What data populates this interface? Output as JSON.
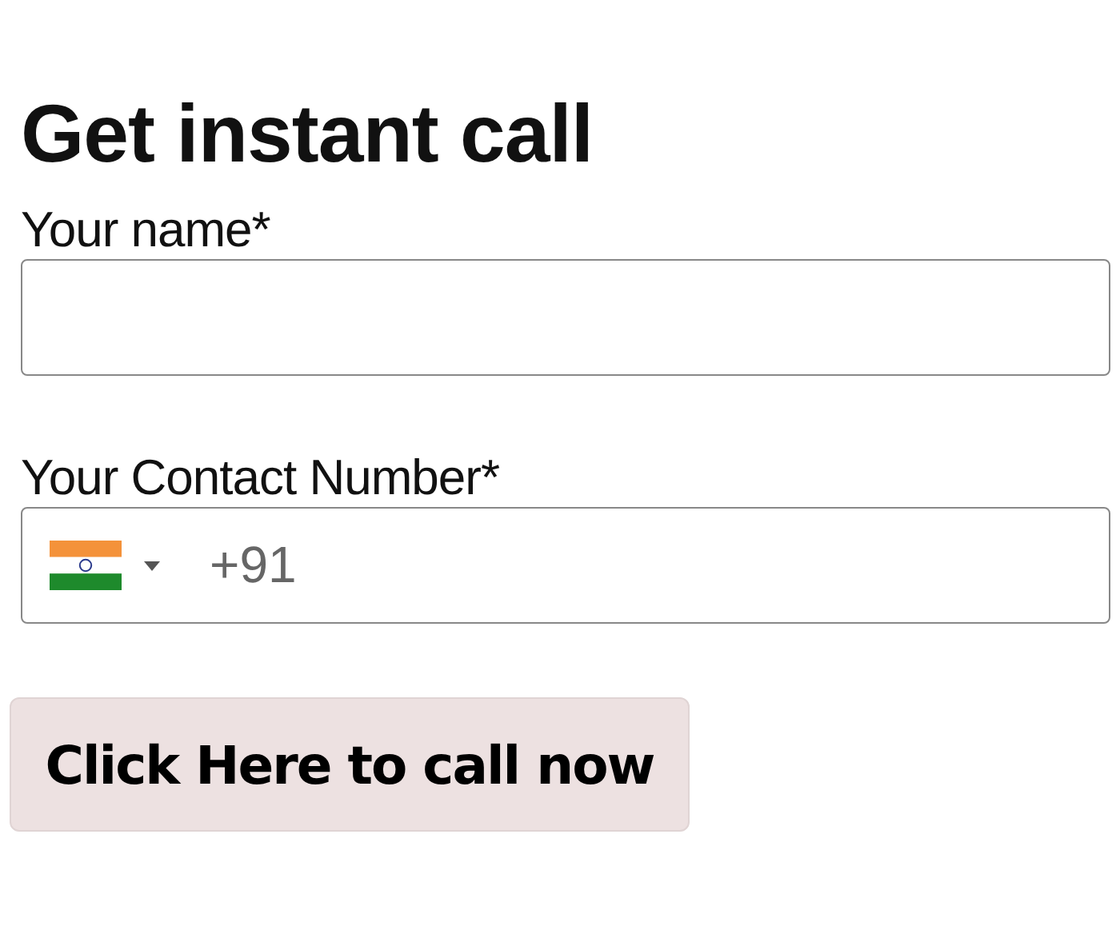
{
  "title": "Get instant call",
  "fields": [
    {
      "kind": "text",
      "label": "Your name*"
    },
    {
      "kind": "phone",
      "label": "Your Contact Number*",
      "dial_code": "+91"
    }
  ],
  "button": "Click Here to call now"
}
